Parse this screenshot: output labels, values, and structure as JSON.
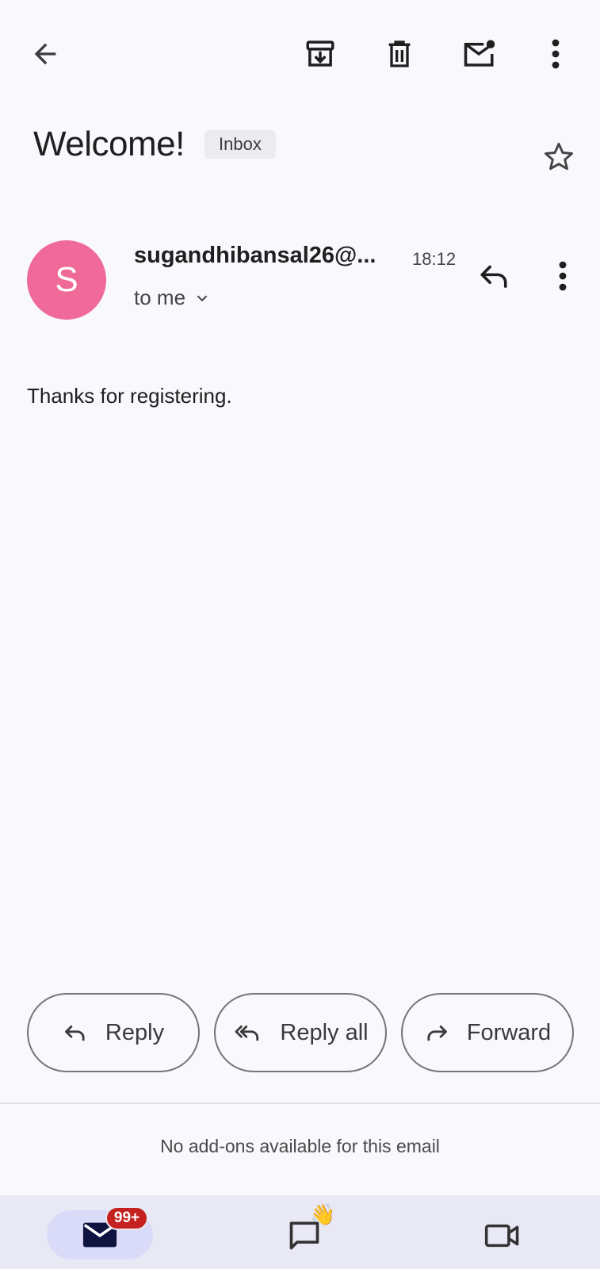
{
  "toolbar": {
    "back": "back-arrow-icon",
    "archive": "archive-icon",
    "delete": "trash-icon",
    "mark_unread": "mark-unread-icon",
    "more": "more-vert-icon"
  },
  "email": {
    "subject": "Welcome!",
    "label": "Inbox",
    "avatar_letter": "S",
    "avatar_color": "#ef6a98",
    "sender": "sugandhibansal26@...",
    "time": "18:12",
    "recipient": "to me",
    "body": "Thanks for registering."
  },
  "actions": {
    "reply": "Reply",
    "reply_all": "Reply all",
    "forward": "Forward"
  },
  "addons_text": "No add-ons available for this email",
  "bottom_nav": {
    "mail_badge": "99+",
    "chat_emoji": "👋",
    "badge_color": "#c5221f",
    "active_pill_color": "#d9dbf8"
  }
}
